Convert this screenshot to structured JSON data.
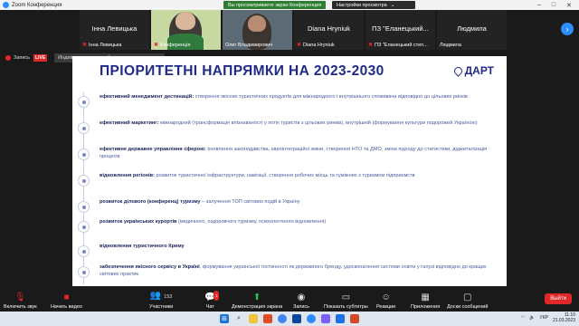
{
  "window": {
    "title": "Zoom Конференция",
    "share_pill_1": "Вы просматриваете экран Конференция",
    "share_pill_2": "Настройки просмотра",
    "share_pill_2_arrow": "⌄",
    "win_min": "–",
    "win_max": "□",
    "win_close": "✕"
  },
  "participants": [
    {
      "big_name": "Інна Левицька",
      "small_name": "Інна Левицька",
      "muted": true
    },
    {
      "big_name": "",
      "small_name": "Конференція",
      "muted": true,
      "video": true
    },
    {
      "big_name": "",
      "small_name": "Олег Владимирович",
      "muted": false,
      "video": true
    },
    {
      "big_name": "Diana Hryniuk",
      "small_name": "Diana Hryniuk",
      "muted": true
    },
    {
      "big_name": "ПЗ \"Еланецький...",
      "small_name": "ПЗ \"Еланецький степ...",
      "muted": true
    },
    {
      "big_name": "Людмила",
      "small_name": "Людмила",
      "muted": false
    }
  ],
  "strip_next": "›",
  "recording": {
    "label": "Запись",
    "live": "LIVE",
    "view_badge": "Индивидуальна служба потокового вещания"
  },
  "slide": {
    "title": "ПРІОРИТЕТНІ НАПРЯМКИ НА 2023-2030",
    "logo": "ДАРТ",
    "items": [
      {
        "bold": "ефективний менеджмент дестинацій:",
        "text": " створення якісних туристичних продуктів для міжнародного і внутрішнього споживача відповідно до цільових ринків"
      },
      {
        "bold": "ефективний маркетинг:",
        "text": " міжнародний (трансформація впізнаваності у потік туристів з цільових ринків), внутрішній (формування культури подорожей Україною)"
      },
      {
        "bold": "ефективне державне управління сферою:",
        "text": " оновлення законодавства, євроінтеграційні зміни, створення НТО та ДМО, зміна підходу до статистики, діджиталізація процесів"
      },
      {
        "bold": "відновлення регіонів:",
        "text": " розвиток туристичної інфраструктури, навігації, створення робочих місць та суміжних з туризмом підприємств"
      },
      {
        "bold": "розвиток ділового (конференц) туризму",
        "text": " – залучення ТОП світових подій в Україну"
      },
      {
        "bold": "розвиток українських курортів",
        "text": " (медичного, оздоровчого туризму, психологічного відновлення)"
      },
      {
        "bold": "відновлення туристичного Криму",
        "text": ""
      },
      {
        "bold": "забезпечення якісного сервісу в Україні",
        "text": ", формування української гостинності як державного бренду, удосконалення системи освіти у галузі відповідно до кращих світових практик"
      }
    ]
  },
  "toolbar": {
    "unmute": "Включить звук",
    "video": "Начать видео",
    "participants": "Участники",
    "participants_count": "153",
    "chat": "Чат",
    "chat_badge": "1",
    "share": "Демонстрация экрана",
    "record": "Запись",
    "captions": "Показать субтитры",
    "reactions": "Реакции",
    "apps": "Приложения",
    "whiteboards": "Доски сообщений",
    "exit": "Выйти"
  },
  "taskbar": {
    "lang": "УКР",
    "time": "11:10",
    "date": "21.03.2023"
  }
}
